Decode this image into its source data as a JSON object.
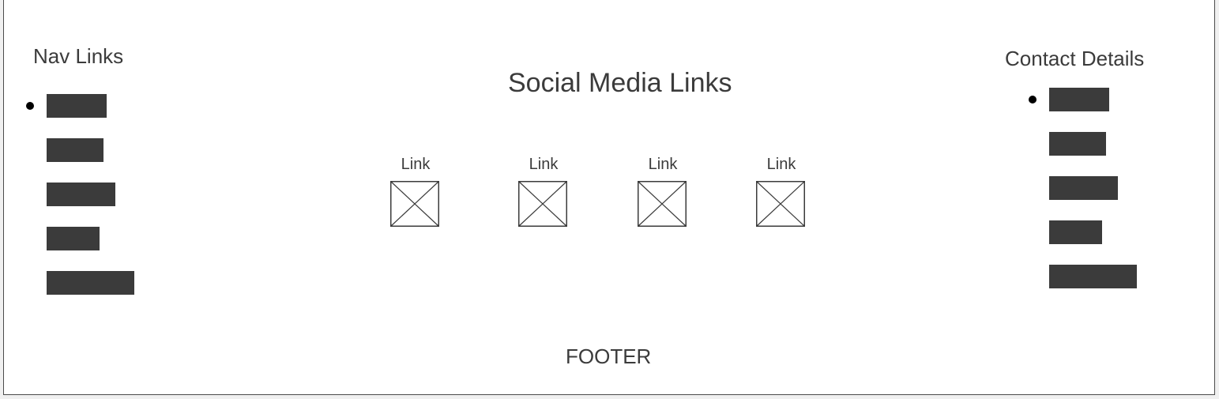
{
  "nav": {
    "title": "Nav Links",
    "items": [
      "",
      "",
      "",
      "",
      ""
    ]
  },
  "social": {
    "title": "Social Media Links",
    "links": [
      {
        "label": "Link",
        "icon": "image-placeholder-icon"
      },
      {
        "label": "Link",
        "icon": "image-placeholder-icon"
      },
      {
        "label": "Link",
        "icon": "image-placeholder-icon"
      },
      {
        "label": "Link",
        "icon": "image-placeholder-icon"
      }
    ]
  },
  "contact": {
    "title": "Contact Details",
    "items": [
      "",
      "",
      "",
      "",
      ""
    ]
  },
  "footer": {
    "label": "FOOTER"
  },
  "colors": {
    "text": "#3b3b3b",
    "bar": "#3b3b3b",
    "border": "#4a4a4a",
    "bullet": "#000000"
  }
}
